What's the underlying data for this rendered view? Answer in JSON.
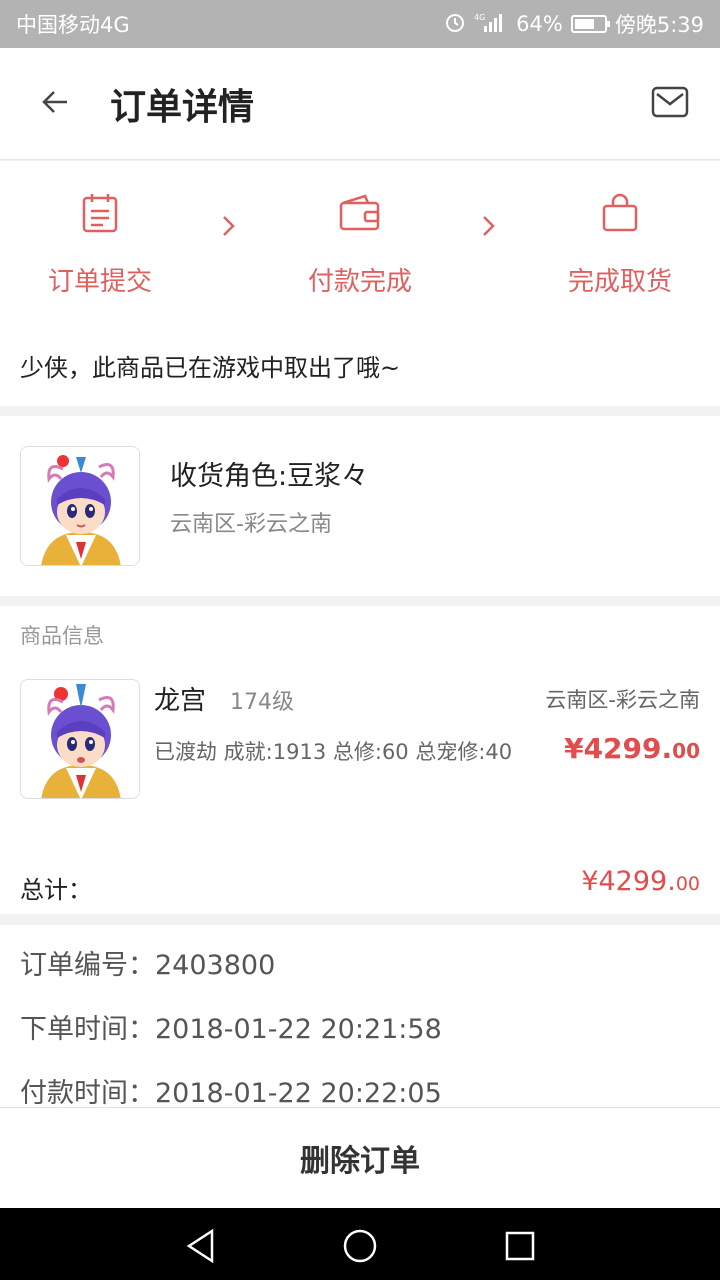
{
  "status_bar": {
    "carrier": "中国移动4G",
    "network": "4G",
    "battery": "64%",
    "battery_level": 0.64,
    "time": "傍晚5:39"
  },
  "header": {
    "title": "订单详情",
    "back_icon": "arrow-left-icon",
    "mail_icon": "mail-icon"
  },
  "steps": [
    {
      "label": "订单提交",
      "icon": "clipboard-icon"
    },
    {
      "label": "付款完成",
      "icon": "wallet-icon"
    },
    {
      "label": "完成取货",
      "icon": "shopping-bag-icon"
    }
  ],
  "notice": "少侠，此商品已在游戏中取出了哦~",
  "receiver": {
    "role": "收货角色:豆浆々",
    "server": "云南区-彩云之南"
  },
  "goods": {
    "section_title": "商品信息",
    "name": "龙宫",
    "level": "174级",
    "server": "云南区-彩云之南",
    "desc": "已渡劫 成就:1913 总修:60 总宠修:40",
    "price_main": "¥4299.",
    "price_dec": "00"
  },
  "total": {
    "label": "总计：",
    "price_main": "¥4299.",
    "price_dec": "00"
  },
  "order": {
    "number": "订单编号：2403800",
    "created": "下单时间：2018-01-22 20:21:58",
    "paid": "付款时间：2018-01-22 20:22:05"
  },
  "actions": {
    "delete": "删除订单"
  },
  "colors": {
    "accent": "#e06060",
    "price": "#e24c4c"
  }
}
